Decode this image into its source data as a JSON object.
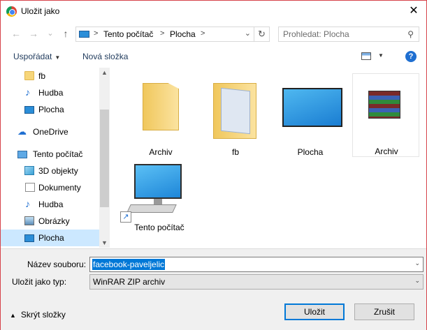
{
  "window": {
    "title": "Uložit jako",
    "close_glyph": "✕"
  },
  "nav": {
    "back_glyph": "←",
    "forward_glyph": "→",
    "recent_glyph": "⌄",
    "up_glyph": "↑",
    "breadcrumb": [
      "Tento počítač",
      "Plocha"
    ],
    "sep_glyph": ">",
    "search_placeholder": "Prohledat: Plocha"
  },
  "toolbar": {
    "organize_label": "Uspořádat",
    "new_folder_label": "Nová složka",
    "help_glyph": "?"
  },
  "sidebar": {
    "items": [
      {
        "label": "fb",
        "icon": "folder-icon"
      },
      {
        "label": "Hudba",
        "icon": "music-icon"
      },
      {
        "label": "Plocha",
        "icon": "desktop-icon"
      },
      {
        "label": "OneDrive",
        "icon": "cloud-icon"
      },
      {
        "label": "Tento počítač",
        "icon": "computer-icon"
      },
      {
        "label": "3D objekty",
        "icon": "cube-icon"
      },
      {
        "label": "Dokumenty",
        "icon": "document-icon"
      },
      {
        "label": "Hudba",
        "icon": "music-icon"
      },
      {
        "label": "Obrázky",
        "icon": "pictures-icon"
      },
      {
        "label": "Plocha",
        "icon": "desktop-icon"
      }
    ]
  },
  "content": {
    "items": [
      {
        "label": "Archiv",
        "type": "folder"
      },
      {
        "label": "fb",
        "type": "folder"
      },
      {
        "label": "Plocha",
        "type": "desktop"
      },
      {
        "label": "Archiv",
        "type": "winrar-archive"
      },
      {
        "label": "Tento počítač",
        "type": "computer-shortcut"
      }
    ]
  },
  "form": {
    "filename_label": "Název souboru:",
    "filename_value": "facebook-paveljelic",
    "filetype_label": "Uložit jako typ:",
    "filetype_value": "WinRAR ZIP archiv"
  },
  "footer": {
    "hide_folders_label": "Skrýt složky",
    "save_label": "Uložit",
    "cancel_label": "Zrušit"
  },
  "colors": {
    "accent": "#0078d7",
    "selection": "#cce8ff",
    "border_red": "#d6434a"
  }
}
